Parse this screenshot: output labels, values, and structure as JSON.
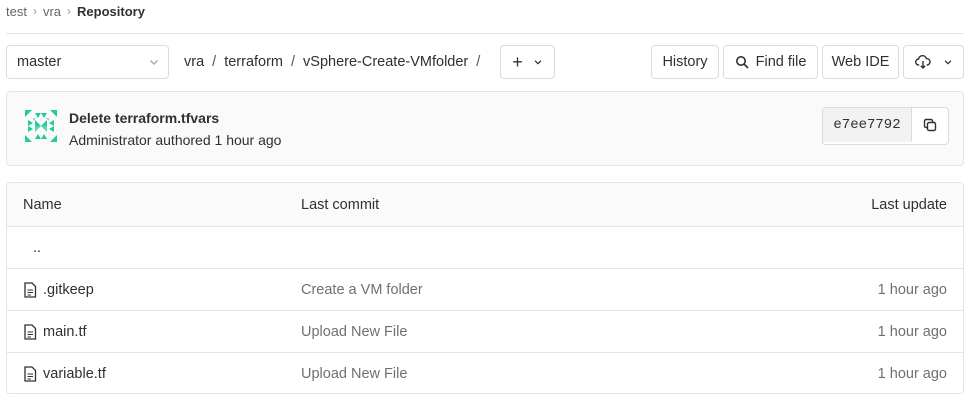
{
  "breadcrumb": {
    "items": [
      "test",
      "vra",
      "Repository"
    ]
  },
  "toolbar": {
    "branch": "master",
    "path": [
      "vra",
      "terraform",
      "vSphere-Create-VMfolder"
    ],
    "add_label": "+",
    "history_label": "History",
    "find_file_label": "Find file",
    "web_ide_label": "Web IDE"
  },
  "commit": {
    "title": "Delete terraform.tfvars",
    "meta": "Administrator authored 1 hour ago",
    "sha": "e7ee7792"
  },
  "table": {
    "headers": {
      "name": "Name",
      "last_commit": "Last commit",
      "last_update": "Last update"
    },
    "parent": "..",
    "rows": [
      {
        "name": ".gitkeep",
        "commit": "Create a VM folder",
        "updated": "1 hour ago"
      },
      {
        "name": "main.tf",
        "commit": "Upload New File",
        "updated": "1 hour ago"
      },
      {
        "name": "variable.tf",
        "commit": "Upload New File",
        "updated": "1 hour ago"
      }
    ]
  },
  "colors": {
    "avatar": "#26c99a",
    "border": "#dbdbdb",
    "muted_text": "#707070"
  },
  "icons": [
    "chevron-right-icon",
    "chevron-down-icon",
    "search-icon",
    "download-icon",
    "copy-icon",
    "file-icon",
    "identicon-avatar"
  ]
}
